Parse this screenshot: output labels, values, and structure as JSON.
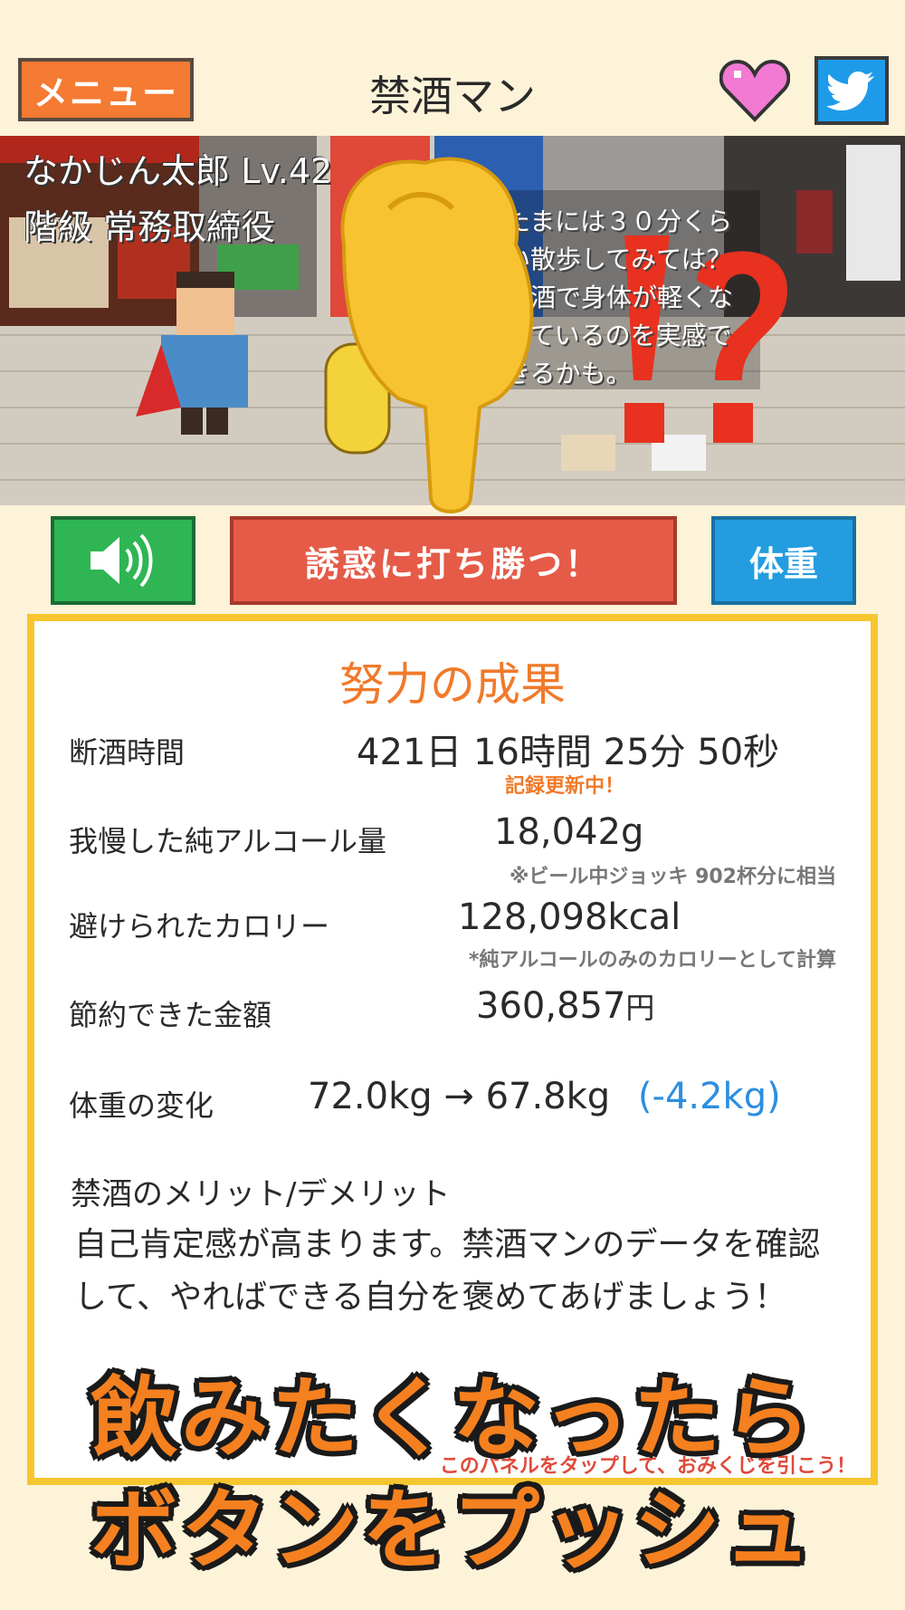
{
  "header": {
    "menu_label": "メニュー",
    "title": "禁酒マン"
  },
  "scene": {
    "player_name": "なかじん太郎 Lv.42",
    "rank": "階級 常務取締役",
    "tip": "たまには３０分くらい散歩してみては？禁酒で身体が軽くなっているのを実感できるかも。"
  },
  "actions": {
    "resist_label": "誘惑に打ち勝つ！",
    "weight_label": "体重"
  },
  "results": {
    "title": "努力の成果",
    "abstinence_label": "断酒時間",
    "abstinence_value": "421日 16時間 25分 50秒",
    "record_note": "記録更新中！",
    "alcohol_label": "我慢した純アルコール量",
    "alcohol_value": "18,042g",
    "alcohol_note": "※ビール中ジョッキ 902杯分に相当",
    "calorie_label": "避けられたカロリー",
    "calorie_value": "128,098kcal",
    "calorie_note": "*純アルコールのみのカロリーとして計算",
    "money_label": "節約できた金額",
    "money_value": "360,857",
    "money_unit": "円",
    "weight_label": "体重の変化",
    "weight_value": "72.0kg → 67.8kg",
    "weight_diff": "(-4.2kg)",
    "merit_title": "禁酒のメリット/デメリット",
    "merit_text": "自己肯定感が高まります。禁酒マンのデータを確認して、やればできる自分を褒めてあげましょう！",
    "tap_note": "このパネルをタップして、おみくじを引こう！"
  },
  "caption": {
    "line1": "飲みたくなったら",
    "line2": "ボタンをプッシュ"
  },
  "colors": {
    "background": "#fcf3d8",
    "menu": "#f57a32",
    "resist": "#e55b48",
    "sound": "#2fb553",
    "weight": "#239de0",
    "panel_border": "#f6c62f",
    "accent": "#f07a2a"
  },
  "icons": [
    "heart-icon",
    "twitter-bird-icon",
    "speaker-icon",
    "pointing-hand-icon"
  ]
}
